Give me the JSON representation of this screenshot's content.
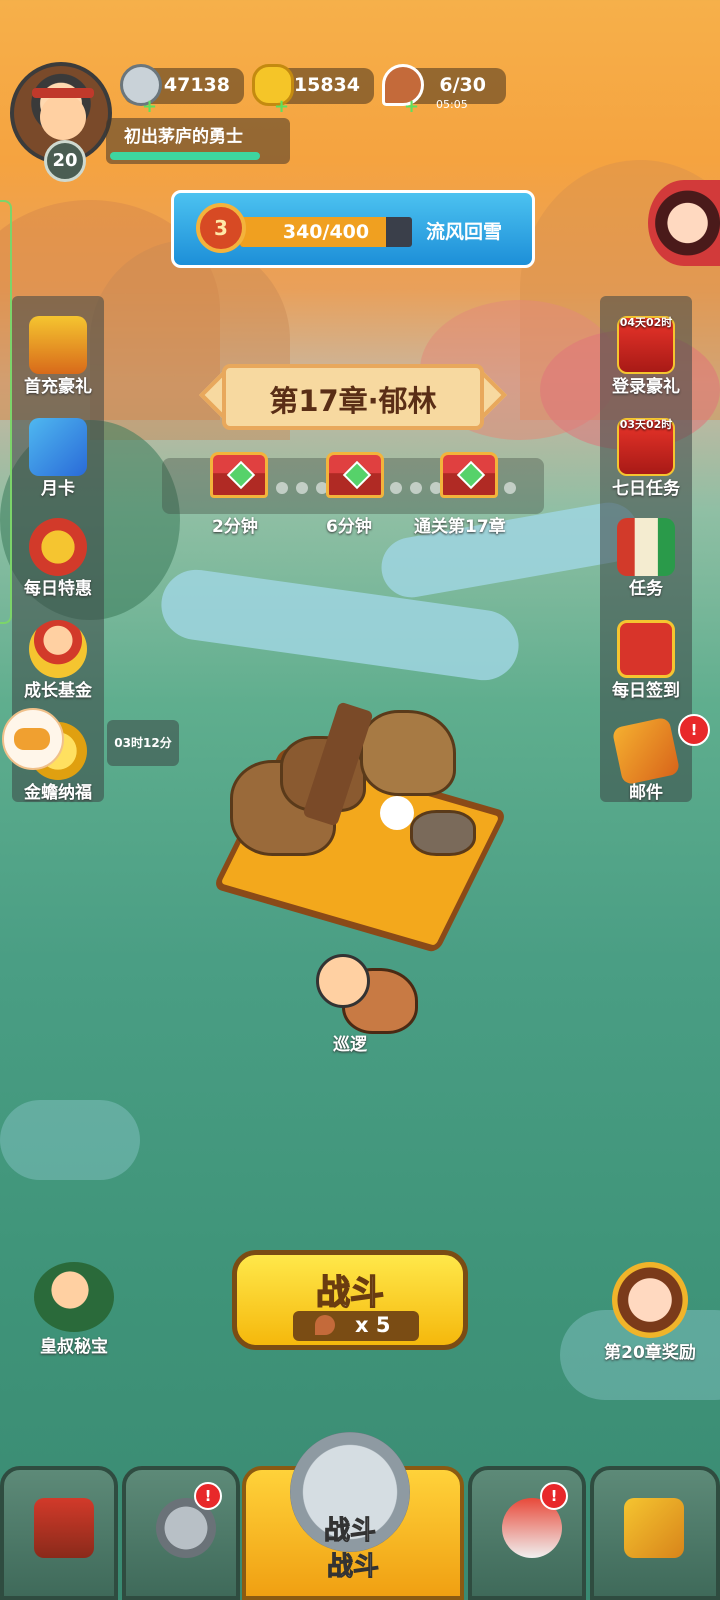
{
  "player": {
    "level": "20",
    "title": "初出茅庐的勇士"
  },
  "resources": [
    {
      "name": "silver-coin",
      "value": "47138",
      "icon": "coin-icon"
    },
    {
      "name": "gold-ingot",
      "value": "15834",
      "icon": "ingot-icon"
    },
    {
      "name": "stamina",
      "value": "6/30",
      "timer": "05:05",
      "icon": "meat-icon"
    }
  ],
  "rank": {
    "tier": "3",
    "progress_text": "340/400",
    "progress_fraction": 0.85,
    "name": "流风回雪"
  },
  "left_menu": [
    {
      "label": "首充豪礼",
      "icon": "gift-chest-icon"
    },
    {
      "label": "月卡",
      "icon": "month-card-icon"
    },
    {
      "label": "每日特惠",
      "icon": "money-bag-icon"
    },
    {
      "label": "成长基金",
      "icon": "growth-fund-icon"
    },
    {
      "label": "金蟾纳福",
      "icon": "golden-toad-icon"
    }
  ],
  "left_timer": "03时12分",
  "right_menu": [
    {
      "label": "登录豪礼",
      "timer": "04天02时",
      "icon": "login-gift-icon"
    },
    {
      "label": "七日任务",
      "timer": "03天02时",
      "icon": "seven-day-icon"
    },
    {
      "label": "任务",
      "icon": "scroll-icon"
    },
    {
      "label": "每日签到",
      "icon": "sign-in-icon"
    },
    {
      "label": "邮件",
      "icon": "mail-icon",
      "badge": "!"
    }
  ],
  "chapter": {
    "title": "第17章·郁林",
    "rewards": [
      {
        "label": "2分钟"
      },
      {
        "label": "6分钟"
      },
      {
        "label": "通关第17章"
      }
    ]
  },
  "hero": {
    "status": "巡逻"
  },
  "battle": {
    "label": "战斗",
    "cost": "x 5"
  },
  "corner_left": {
    "label": "皇叔秘宝"
  },
  "corner_right": {
    "label": "第20章奖励"
  },
  "bottom_nav": [
    {
      "name": "city",
      "icon": "castle-icon"
    },
    {
      "name": "hero",
      "icon": "helmet-icon",
      "badge": "!"
    },
    {
      "name": "battle",
      "label": "战斗",
      "icon": "swords-icon"
    },
    {
      "name": "formation",
      "icon": "banner-icon",
      "badge": "!"
    },
    {
      "name": "upgrade",
      "icon": "fist-icon"
    }
  ]
}
